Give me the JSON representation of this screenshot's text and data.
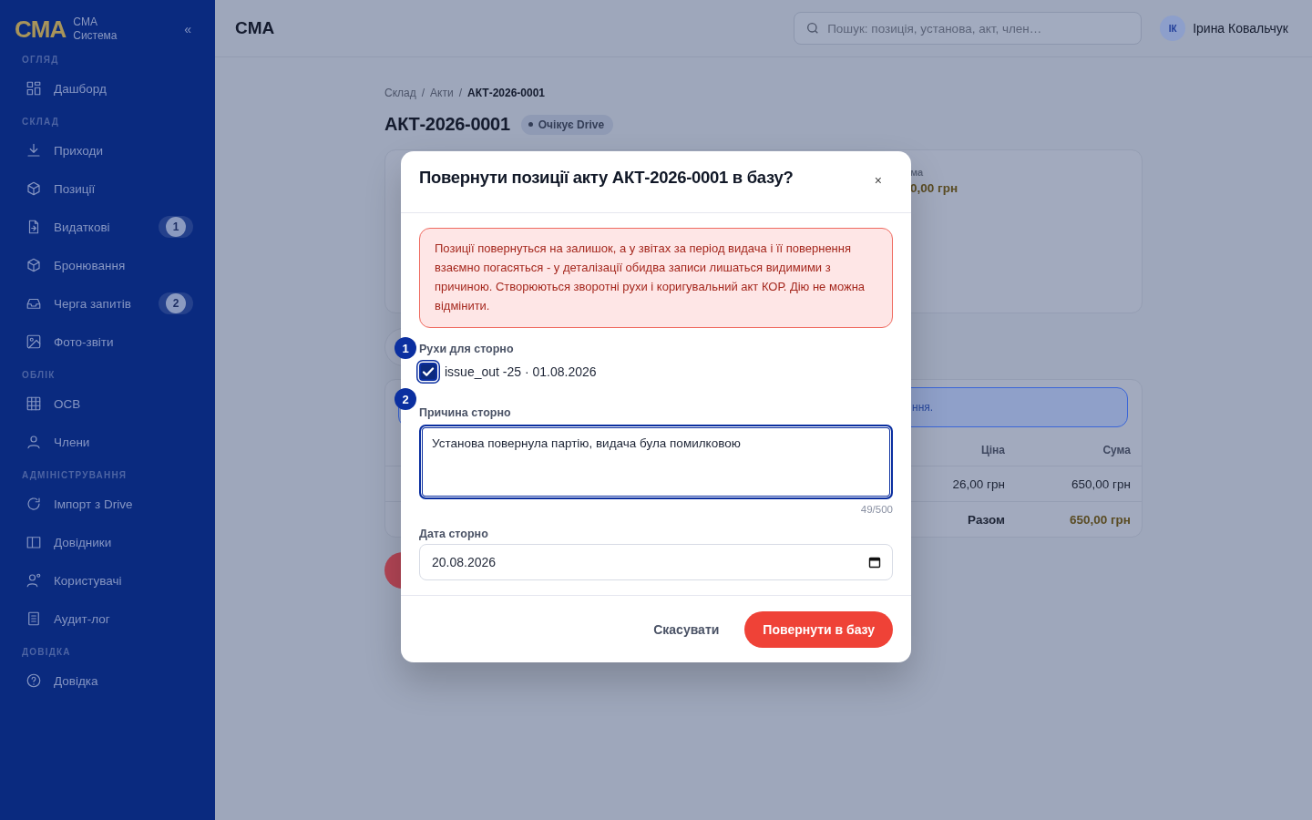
{
  "brand": {
    "logo": "CMA",
    "name": "CMA",
    "subtitle": "Система",
    "collapse": "«"
  },
  "sidebar": {
    "sections": [
      {
        "title": "ОГЛЯД",
        "items": [
          {
            "label": "Дашборд"
          }
        ]
      },
      {
        "title": "СКЛАД",
        "items": [
          {
            "label": "Приходи"
          },
          {
            "label": "Позиції"
          },
          {
            "label": "Видаткові",
            "badge": "1"
          },
          {
            "label": "Бронювання"
          },
          {
            "label": "Черга запитів",
            "badge": "2"
          },
          {
            "label": "Фото-звіти"
          }
        ]
      },
      {
        "title": "ОБЛІК",
        "items": [
          {
            "label": "ОСВ"
          },
          {
            "label": "Члени"
          }
        ]
      },
      {
        "title": "АДМІНІСТРУВАННЯ",
        "items": [
          {
            "label": "Імпорт з Drive"
          },
          {
            "label": "Довідники"
          },
          {
            "label": "Користувачі"
          },
          {
            "label": "Аудит-лог"
          }
        ]
      },
      {
        "title": "ДОВІДКА",
        "items": [
          {
            "label": "Довідка"
          }
        ]
      }
    ]
  },
  "header": {
    "title": "CMA",
    "search": {
      "placeholder": "Пошук: позиція, установа, акт, член…"
    },
    "user": {
      "initials": "ІК",
      "name": "Ірина Ковальчук"
    }
  },
  "breadcrumb": {
    "items": [
      "Склад",
      "Акти",
      "АКТ-2026-0001"
    ],
    "separator": "/"
  },
  "page": {
    "title": "АКТ-2026-0001",
    "status": "Очікує Drive"
  },
  "background": {
    "summary_label": "ма",
    "summary_value": "0,00 грн",
    "notice": "ння.",
    "table": {
      "columns": [
        "Ціна",
        "Сума"
      ],
      "rows": [
        [
          "26,00 грн",
          "650,00 грн"
        ]
      ],
      "total_label": "Разом",
      "total_value": "650,00 грн"
    }
  },
  "dialog": {
    "title": "Повернути позиції акту АКТ-2026-0001 в базу?",
    "close": "×",
    "warning": "Позиції повернуться на залишок, а у звітах за період видача і її повернення взаємно погасяться - у деталізації обидва записи лишаться видимими з причиною. Створюються зворотні рухи і коригувальний акт КОР. Дію не можна відмінити.",
    "movements": {
      "label": "Рухи для сторно",
      "items": [
        {
          "label": "issue_out -25 · 01.08.2026",
          "checked": true
        }
      ]
    },
    "reason": {
      "label": "Причина сторно",
      "value": "Установа повернула партію, видача була помилковою",
      "counter": "49/500"
    },
    "date": {
      "label": "Дата сторно",
      "value": "20.08.2026"
    },
    "buttons": {
      "cancel": "Скасувати",
      "confirm": "Повернути в базу"
    }
  },
  "markers": [
    "1",
    "2"
  ]
}
